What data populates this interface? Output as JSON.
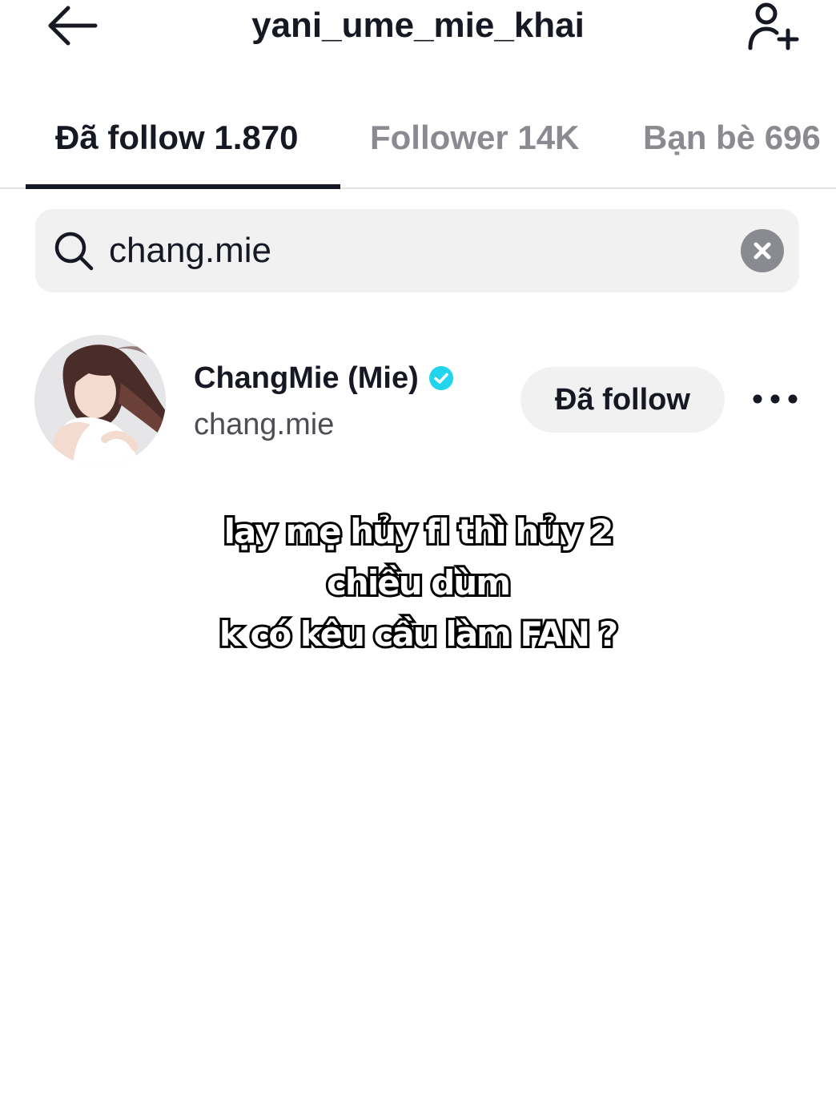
{
  "header": {
    "title": "yani_ume_mie_khai",
    "back_icon": "arrow-left-icon",
    "add_user_icon": "person-add-icon"
  },
  "tabs": [
    {
      "label": "Đã follow 1.870",
      "active": true
    },
    {
      "label": "Follower 14K",
      "active": false
    },
    {
      "label": "Bạn bè 696",
      "active": false
    }
  ],
  "search": {
    "value": "chang.mie",
    "icon": "search-icon",
    "clear_icon": "clear-circle-icon"
  },
  "results": [
    {
      "display_name": "ChangMie (Mie)",
      "verified": true,
      "username": "chang.mie",
      "button_label": "Đã follow",
      "more_icon": "more-horizontal-icon"
    }
  ],
  "caption": {
    "lines": [
      "lạy mẹ hủy fl thì hủy 2",
      "chiều dùm",
      "k có kêu cầu làm FAN ?"
    ]
  },
  "colors": {
    "text_primary": "#161823",
    "text_secondary": "#8a8b91",
    "verified_blue": "#20d5ec",
    "surface_gray": "#f1f1f2"
  }
}
